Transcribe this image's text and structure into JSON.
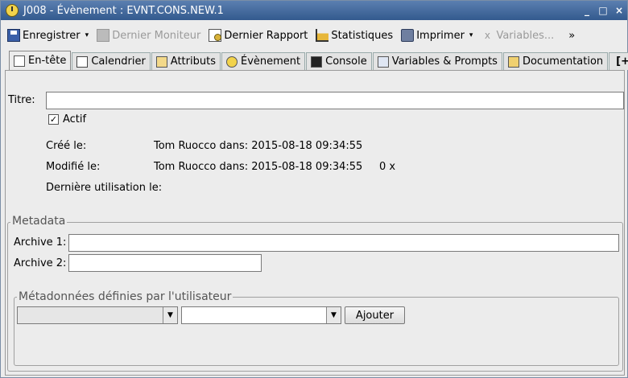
{
  "window": {
    "title": "J008 - Évènement : EVNT.CONS.NEW.1",
    "minimize": "_",
    "maximize": "□",
    "close": "×"
  },
  "toolbar": {
    "save_label": "Enregistrer",
    "last_monitor_label": "Dernier Moniteur",
    "last_report_label": "Dernier Rapport",
    "statistics_label": "Statistiques",
    "print_label": "Imprimer",
    "variables_label": "Variables...",
    "overflow_label": "»",
    "caret": "▾"
  },
  "tabs": [
    {
      "label": "En-tête",
      "active": true
    },
    {
      "label": "Calendrier"
    },
    {
      "label": "Attributs"
    },
    {
      "label": "Évènement"
    },
    {
      "label": "Console"
    },
    {
      "label": "Variables & Prompts"
    },
    {
      "label": "Documentation"
    },
    {
      "label": "[+]"
    }
  ],
  "header": {
    "title_label": "Titre:",
    "title_value": "",
    "active_label": "Actif",
    "active_checked": true,
    "created_label": "Créé le:",
    "created_value": "Tom Ruocco dans: 2015-08-18 09:34:55",
    "modified_label": "Modifié le:",
    "modified_value": "Tom Ruocco dans: 2015-08-18 09:34:55",
    "modified_count": "0 x",
    "last_used_label": "Dernière utilisation le:"
  },
  "metadata": {
    "group_title": "Metadata",
    "archive1_label": "Archive 1:",
    "archive1_value": "",
    "archive2_label": "Archive 2:",
    "archive2_value": "",
    "user_group_title": "Métadonnées définies par l'utilisateur",
    "add_button_label": "Ajouter",
    "combo_arrow": "▼"
  }
}
